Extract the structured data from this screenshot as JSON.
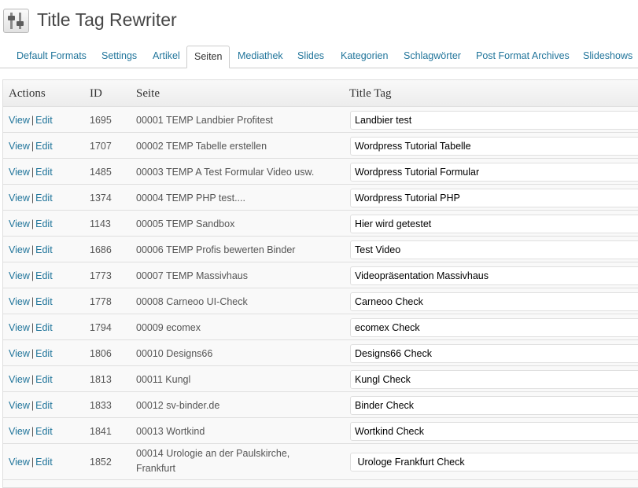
{
  "header": {
    "title": "Title Tag Rewriter",
    "icon": "sliders-icon"
  },
  "tabs": [
    {
      "label": "Default Formats",
      "active": false
    },
    {
      "label": "Settings",
      "active": false
    },
    {
      "label": "Artikel",
      "active": false
    },
    {
      "label": "Seiten",
      "active": true
    },
    {
      "label": "Mediathek",
      "active": false
    },
    {
      "label": "Slides",
      "active": false
    },
    {
      "label": "Kategorien",
      "active": false
    },
    {
      "label": "Schlagwörter",
      "active": false
    },
    {
      "label": "Post Format Archives",
      "active": false
    },
    {
      "label": "Slideshows",
      "active": false
    }
  ],
  "table": {
    "columns": [
      "Actions",
      "ID",
      "Seite",
      "Title Tag"
    ],
    "view_label": "View",
    "edit_label": "Edit",
    "separator": "|",
    "rows": [
      {
        "id": "1695",
        "page": "00001 TEMP Landbier Profitest",
        "title_tag": "Landbier test"
      },
      {
        "id": "1707",
        "page": "00002 TEMP Tabelle erstellen",
        "title_tag": "Wordpress Tutorial Tabelle"
      },
      {
        "id": "1485",
        "page": "00003 TEMP A Test Formular Video usw.",
        "title_tag": "Wordpress Tutorial Formular"
      },
      {
        "id": "1374",
        "page": "00004 TEMP PHP test....",
        "title_tag": "Wordpress Tutorial PHP"
      },
      {
        "id": "1143",
        "page": "00005 TEMP Sandbox",
        "title_tag": "Hier wird getestet"
      },
      {
        "id": "1686",
        "page": "00006 TEMP Profis bewerten Binder",
        "title_tag": "Test Video"
      },
      {
        "id": "1773",
        "page": "00007 TEMP Massivhaus",
        "title_tag": "Videopräsentation Massivhaus"
      },
      {
        "id": "1778",
        "page": "00008 Carneoo UI-Check",
        "title_tag": "Carneoo Check"
      },
      {
        "id": "1794",
        "page": "00009 ecomex",
        "title_tag": "ecomex Check"
      },
      {
        "id": "1806",
        "page": "00010 Designs66",
        "title_tag": "Designs66 Check"
      },
      {
        "id": "1813",
        "page": "00011 Kungl",
        "title_tag": "Kungl Check"
      },
      {
        "id": "1833",
        "page": "00012 sv-binder.de",
        "title_tag": "Binder Check"
      },
      {
        "id": "1841",
        "page": "00013 Wortkind",
        "title_tag": "Wortkind Check"
      },
      {
        "id": "1852",
        "page": "00014 Urologie an der Paulskirche, Frankfurt",
        "title_tag": " Urologe Frankfurt Check"
      }
    ]
  },
  "colors": {
    "link": "#21759b",
    "border": "#dfdfdf",
    "row_bg": "#f9f9f9"
  }
}
